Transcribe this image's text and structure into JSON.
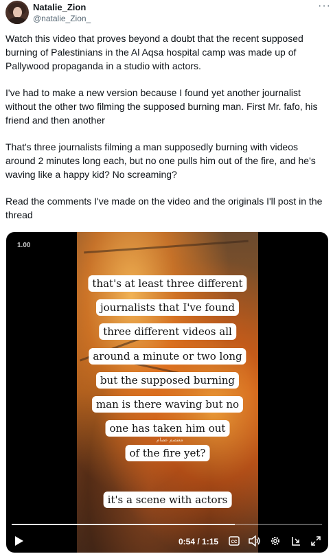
{
  "author": {
    "display_name": "Natalie_Zion",
    "handle": "@natalie_Zion_"
  },
  "more_label": "···",
  "tweet": {
    "paragraphs": [
      "Watch this video that proves beyond a doubt that the recent supposed burning of Palestinians in the Al Aqsa hospital camp was made up of Pallywood propaganda in a studio with actors.",
      "I've had to make a new version because I found yet another journalist without the other two filming the supposed burning man.  First Mr. fafo, his friend and then another",
      "That's three journalists filming a man supposedly burning with  videos around 2 minutes long each, but no one pulls him out of the fire, and he's waving like a happy kid? No screaming?",
      "Read the comments I've made on the video and the originals I'll post in the thread"
    ]
  },
  "video": {
    "badge": "1.00",
    "captions": [
      "that's at least three different",
      "journalists that I've found",
      "three different videos all",
      "around a minute or two long",
      "but the supposed burning",
      "man is there waving but no",
      "one has taken him out",
      "of the fire yet?"
    ],
    "final_caption": "it's a scene with actors",
    "watermark": "معتصم عصام",
    "time_display": "0:54 / 1:15",
    "progress": 0.72,
    "icons": [
      "play-icon",
      "captions-icon",
      "volume-icon",
      "settings-icon",
      "pip-icon",
      "fullscreen-icon"
    ]
  }
}
